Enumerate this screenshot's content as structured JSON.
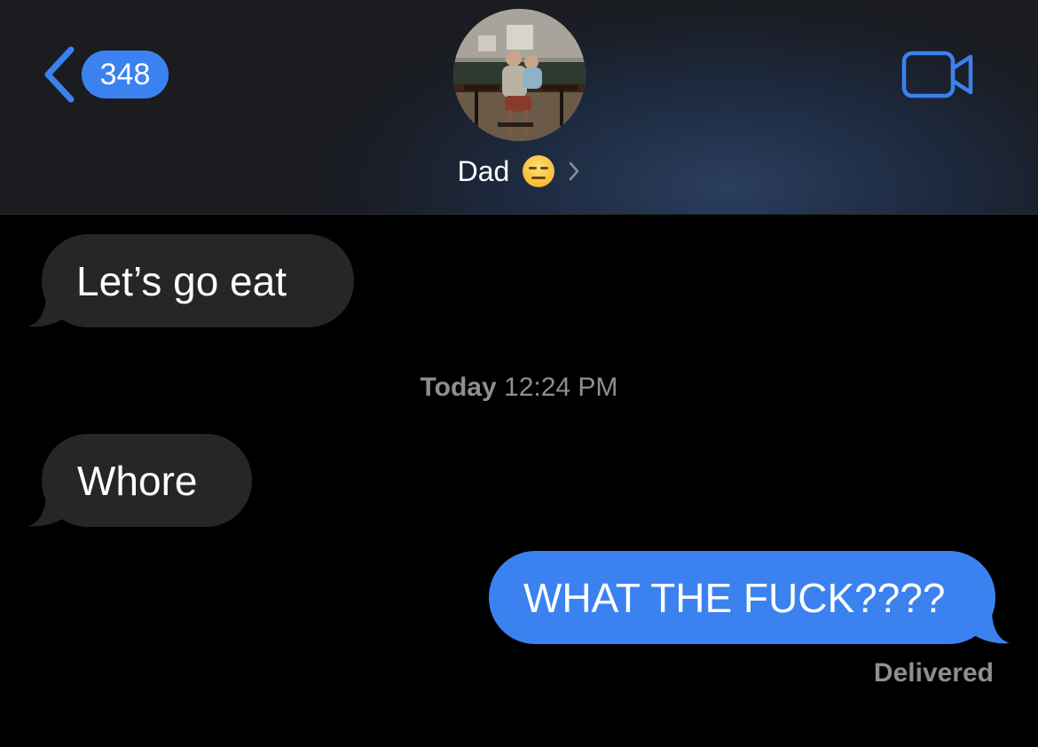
{
  "header": {
    "back_count": "348",
    "contact_name": "Dad",
    "contact_emoji": "expressionless-face-emoji",
    "icons": {
      "back": "chevron-left-icon",
      "video": "video-camera-icon",
      "disclosure": "chevron-right-icon"
    },
    "accent": "#3b82f0"
  },
  "messages": [
    {
      "direction": "incoming",
      "text": "Let’s go eat"
    },
    {
      "direction": "incoming",
      "text": "Whore"
    },
    {
      "direction": "outgoing",
      "text": "WHAT THE FUCK????"
    }
  ],
  "timestamp": {
    "day": "Today",
    "time": "12:24 PM"
  },
  "status": "Delivered",
  "colors": {
    "incoming_bubble": "#262629",
    "outgoing_bubble": "#3b82f0",
    "background": "#000000",
    "secondary_text": "#8e8e93"
  }
}
